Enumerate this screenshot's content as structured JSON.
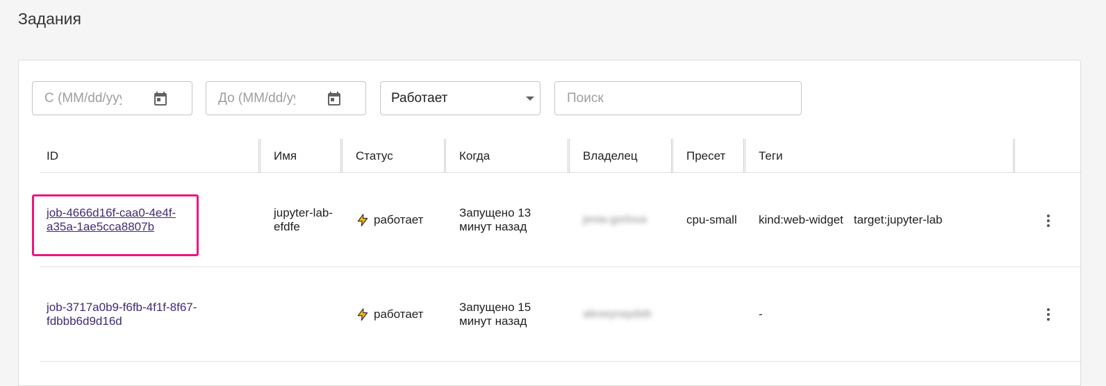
{
  "page": {
    "title": "Задания"
  },
  "filters": {
    "from_date": {
      "placeholder": "С (MM/dd/yyyy)"
    },
    "to_date": {
      "placeholder": "До (MM/dd/yyyy)"
    },
    "status_select": {
      "value": "Работает"
    },
    "search": {
      "placeholder": "Поиск"
    }
  },
  "table": {
    "columns": [
      "ID",
      "Имя",
      "Статус",
      "Когда",
      "Владелец",
      "Пресет",
      "Теги"
    ],
    "rows": [
      {
        "id": "job-4666d16f-caa0-4e4f-a35a-1ae5cca8807b",
        "id_line1": "job-4666d16f-caa0-4e4f-",
        "id_line2": "a35a-1ae5cca8807b",
        "name_line1": "jupyter-lab-",
        "name_line2": "efdfe",
        "status": "работает",
        "when_line1": "Запущено 13",
        "when_line2": "минут назад",
        "owner": "jenia-gorlova",
        "preset": "cpu-small",
        "tags": [
          "kind:web-widget",
          "target:jupyter-lab"
        ]
      },
      {
        "id": "job-3717a0b9-f6fb-4f1f-8f67-fdbbb6d9d16d",
        "id_line1": "job-3717a0b9-f6fb-4f1f-8f67-",
        "id_line2": "fdbbb6d9d16d",
        "name_line1": "",
        "name_line2": "",
        "status": "работает",
        "when_line1": "Запущено 15",
        "when_line2": "минут назад",
        "owner": "alexeynaydeb",
        "preset": "",
        "tags_text": "-"
      }
    ]
  },
  "colors": {
    "link": "#3f2a7a",
    "highlight": "#f0137f",
    "bolt": "#f5b800"
  },
  "icons": [
    "calendar-icon",
    "chevron-down-icon",
    "lightning-icon",
    "more-vert-icon"
  ]
}
